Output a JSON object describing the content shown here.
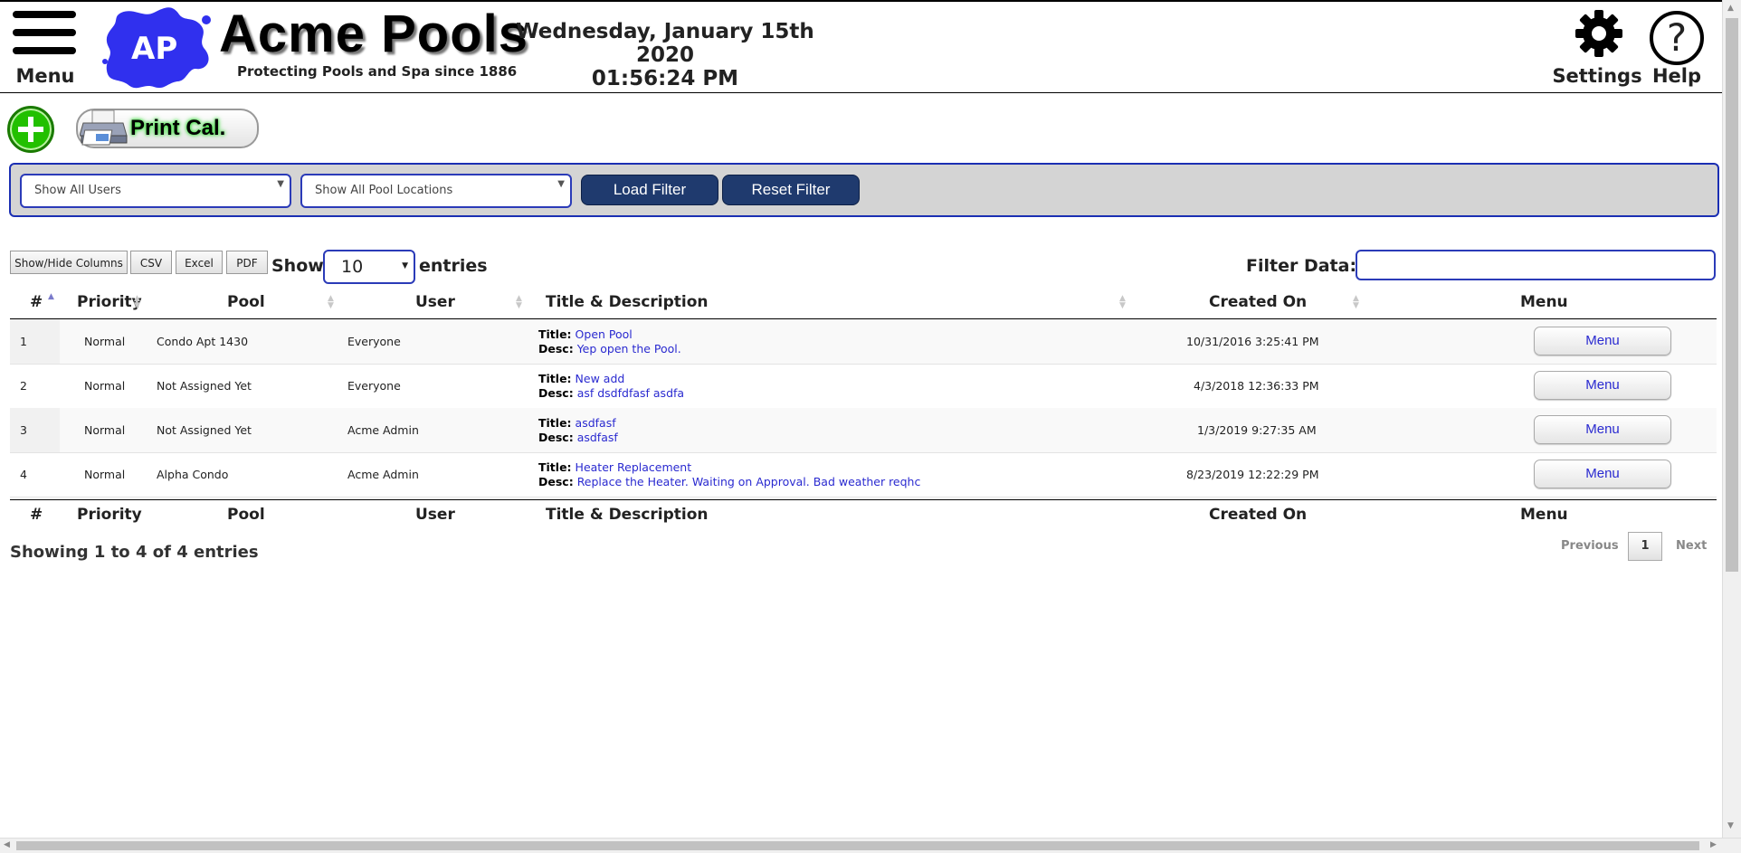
{
  "header": {
    "menu_label": "Menu",
    "logo_text": "AP",
    "brand_title": "Acme Pools",
    "brand_subtitle": "Protecting Pools and Spa since 1886",
    "date": "Wednesday, January 15th 2020",
    "time": "01:56:24 PM",
    "settings_label": "Settings",
    "help_label": "Help",
    "help_glyph": "?"
  },
  "actions": {
    "print_label": "Print Cal."
  },
  "filters": {
    "users_select": "Show All Users",
    "locations_select": "Show All Pool Locations",
    "load_label": "Load Filter",
    "reset_label": "Reset Filter"
  },
  "tools": {
    "show_hide": "Show/Hide Columns",
    "csv": "CSV",
    "excel": "Excel",
    "pdf": "PDF",
    "show_label": "Show",
    "entries_value": "10",
    "entries_label": "entries",
    "filter_label": "Filter Data:",
    "filter_value": ""
  },
  "table": {
    "columns": [
      "#",
      "Priority",
      "Pool",
      "User",
      "Title & Description",
      "Created On",
      "Menu"
    ],
    "title_prefix": "Title:",
    "desc_prefix": "Desc:",
    "rows": [
      {
        "num": "1",
        "priority": "Normal",
        "pool": "Condo Apt 1430",
        "user": "Everyone",
        "title": "Open Pool",
        "desc": "Yep open the Pool.",
        "created": "10/31/2016 3:25:41 PM",
        "menu": "Menu"
      },
      {
        "num": "2",
        "priority": "Normal",
        "pool": "Not Assigned Yet",
        "user": "Everyone",
        "title": "New add",
        "desc": "asf dsdfdfasf asdfa",
        "created": "4/3/2018 12:36:33 PM",
        "menu": "Menu"
      },
      {
        "num": "3",
        "priority": "Normal",
        "pool": "Not Assigned Yet",
        "user": "Acme Admin",
        "title": "asdfasf",
        "desc": "asdfasf",
        "created": "1/3/2019 9:27:35 AM",
        "menu": "Menu"
      },
      {
        "num": "4",
        "priority": "Normal",
        "pool": "Alpha Condo",
        "user": "Acme Admin",
        "title": "Heater Replacement",
        "desc": "Replace the Heater. Waiting on Approval. Bad weather reqhc",
        "created": "8/23/2019 12:22:29 PM",
        "menu": "Menu"
      }
    ]
  },
  "footer": {
    "info": "Showing 1 to 4 of 4 entries",
    "previous": "Previous",
    "page": "1",
    "next": "Next"
  },
  "icons": {
    "menu": "hamburger-icon",
    "settings": "gear-icon",
    "help": "question-icon",
    "add": "plus-icon",
    "print": "printer-icon"
  },
  "colors": {
    "accent_blue": "#1b2fb3",
    "button_dark": "#1f3a6e",
    "add_green": "#22c000",
    "logo_blue": "#3030ee",
    "link_blue": "#2a2ad0"
  }
}
